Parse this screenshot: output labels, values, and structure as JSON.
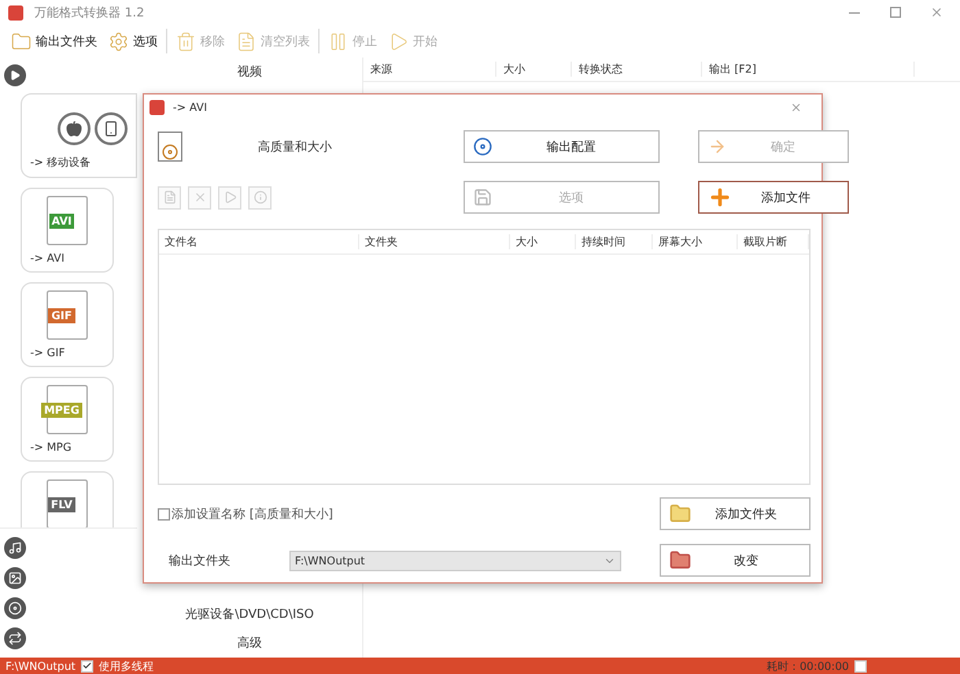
{
  "window": {
    "title": "万能格式转换器 1.2"
  },
  "toolbar": [
    {
      "label": "输出文件夹",
      "disabled": false
    },
    {
      "label": "选项",
      "disabled": false
    },
    {
      "label": "移除",
      "disabled": true
    },
    {
      "label": "清空列表",
      "disabled": true
    },
    {
      "label": "停止",
      "disabled": true
    },
    {
      "label": "开始",
      "disabled": true
    }
  ],
  "sidebar": {
    "cards": [
      {
        "kind": "mobile",
        "label": "-> 移动设备"
      },
      {
        "kind": "format",
        "badge": "AVI",
        "color": "#3d9a3a",
        "label": "-> AVI"
      },
      {
        "kind": "format",
        "badge": "GIF",
        "color": "#d2692e",
        "label": "-> GIF"
      },
      {
        "kind": "format",
        "badge": "MPEG",
        "color": "#a9a82a",
        "label": "-> MPG"
      },
      {
        "kind": "format",
        "badge": "FLV",
        "color": "#666666"
      }
    ]
  },
  "categories": {
    "header": "视频",
    "items": [
      "光驱设备\\DVD\\CD\\ISO",
      "高级"
    ]
  },
  "file_table": {
    "columns": [
      "来源",
      "大小",
      "转换状态",
      "输出 [F2]"
    ]
  },
  "dialog": {
    "title": "-> AVI",
    "preset": "高质量和大小",
    "buttons": [
      {
        "label": "输出配置",
        "disabled": false,
        "focused": false
      },
      {
        "label": "确定",
        "disabled": true,
        "focused": false
      },
      {
        "label": "选项",
        "disabled": true,
        "focused": false
      },
      {
        "label": "添加文件",
        "disabled": false,
        "focused": true
      }
    ],
    "small_tools": [
      {
        "disabled": true
      },
      {
        "disabled": true
      },
      {
        "disabled": true
      },
      {
        "disabled": true
      }
    ],
    "columns": [
      "文件名",
      "文件夹",
      "大小",
      "持续时间",
      "屏幕大小",
      "截取片断"
    ],
    "add_name": {
      "label": "添加设置名称 [高质量和大小]",
      "checked": false
    },
    "add_folder_button": "添加文件夹",
    "output_folder": {
      "label": "输出文件夹",
      "value": "F:\\WNOutput"
    },
    "change_button": "改变"
  },
  "status_bar": {
    "path": "F:\\WNOutput",
    "multithread": {
      "label": "使用多线程",
      "checked": true
    },
    "elapsed": "耗时：00:00:00",
    "shutdown_checked": false
  }
}
